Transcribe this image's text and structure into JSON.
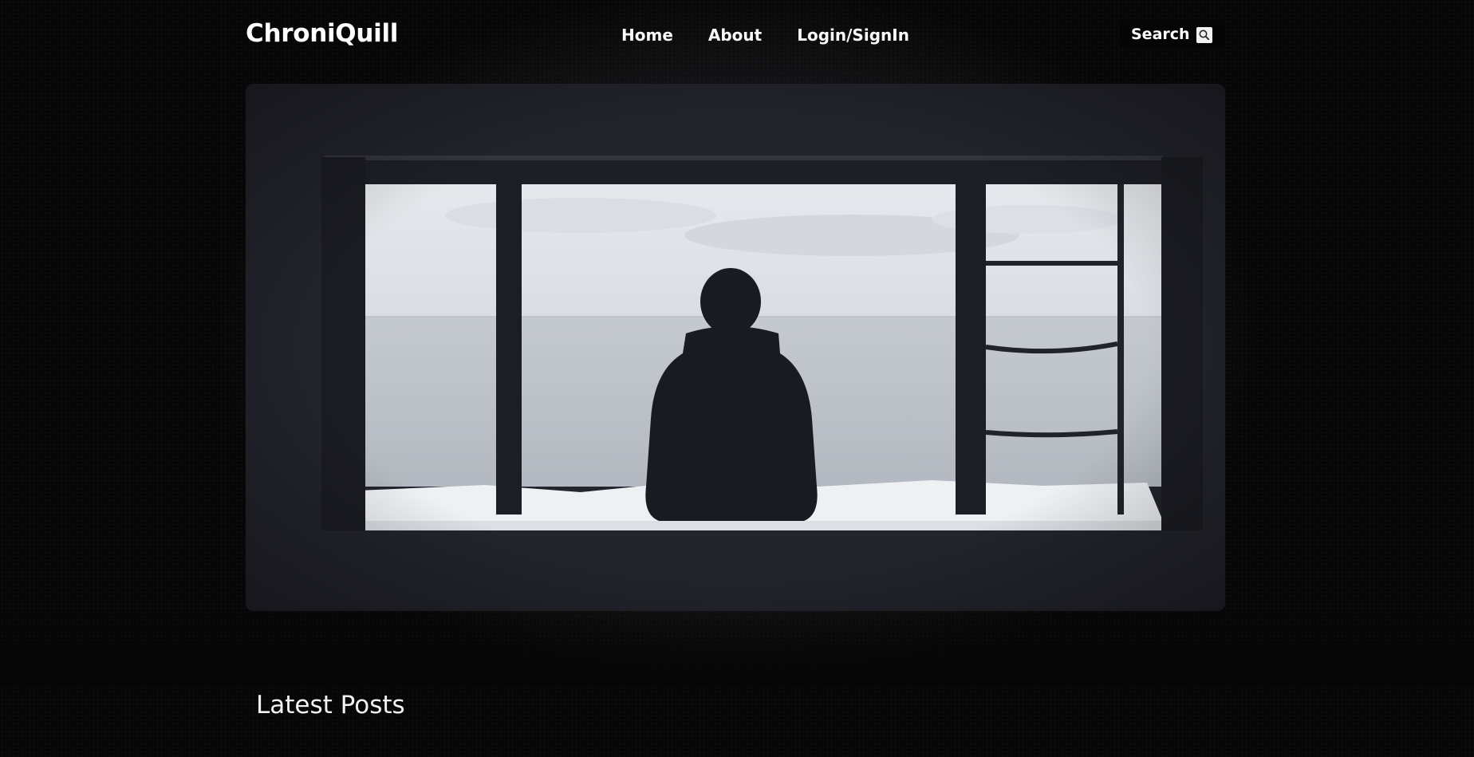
{
  "header": {
    "brand": "ChroniQuill",
    "nav": [
      {
        "label": "Home"
      },
      {
        "label": "About"
      },
      {
        "label": "Login/SignIn"
      }
    ],
    "search_label": "Search",
    "search_icon": "magnifier-icon"
  },
  "hero": {
    "image_subject": "silhouette-at-window-over-sea"
  },
  "latest": {
    "title": "Latest Posts"
  },
  "colors": {
    "background": "#070708",
    "card": "#23242c",
    "text": "#ffffff"
  }
}
